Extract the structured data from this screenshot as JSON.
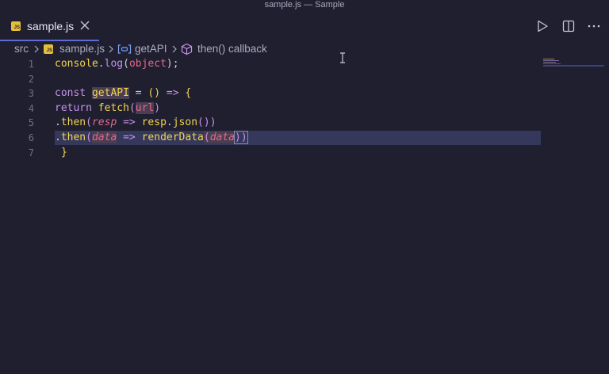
{
  "window": {
    "title": "sample.js — Sample"
  },
  "tab": {
    "badge": "JS",
    "label": "sample.js"
  },
  "breadcrumb": {
    "folder": "src",
    "file": "sample.js",
    "symbol": "getAPI",
    "callback": "then() callback"
  },
  "editor": {
    "line_numbers": [
      "1",
      "2",
      "3",
      "4",
      "5",
      "6",
      "7"
    ],
    "line1": {
      "obj": "console",
      "dot": ".",
      "method": "log",
      "open": "(",
      "arg": "object",
      "close": ");"
    },
    "line3": {
      "kw": "const",
      "name": "getAPI",
      "eq": " = ",
      "parens": "()",
      "arrow": " => ",
      "brace": "{"
    },
    "line4": {
      "kw": "return",
      "fn": "fetch",
      "open": "(",
      "arg": "url",
      "close": ")"
    },
    "line5": {
      "dot": ".",
      "method": "then",
      "open": "(",
      "param": "resp",
      "arrow": " => ",
      "obj": "resp",
      "dot2": ".",
      "call": "json",
      "close": "())"
    },
    "line6": {
      "dot": ".",
      "method": "then",
      "open": "(",
      "param": "data",
      "arrow": " => ",
      "call": "renderData",
      "open2": "(",
      "arg": "data",
      "close": "))"
    },
    "line7": {
      "brace": "}"
    }
  },
  "colors": {
    "background": "#1f1f30",
    "accent": "#5d6bd8",
    "js_badge": "#e4bf3b",
    "keyword": "#c792ea",
    "function": "#f2d34f",
    "parameter": "#e06a8a"
  },
  "icons": {
    "tab_close": "close-icon",
    "run": "play-icon",
    "split": "split-editor-icon",
    "more": "ellipsis-icon",
    "symbol_variable": "variable-icon",
    "symbol_method": "cube-icon"
  }
}
